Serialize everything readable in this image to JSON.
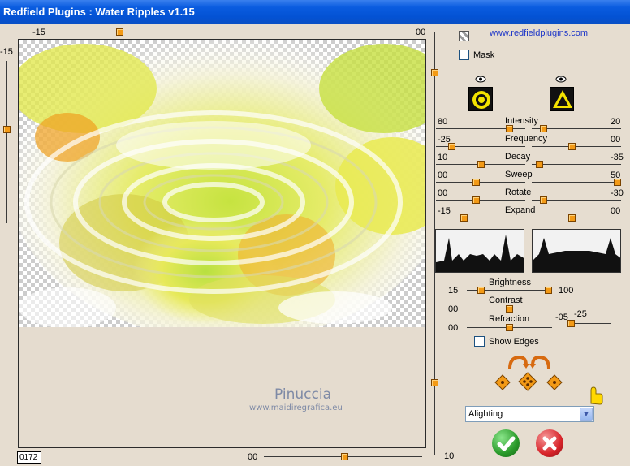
{
  "window": {
    "title": "Redfield Plugins : Water Ripples v1.15"
  },
  "top_slider": {
    "left_value": "-15",
    "right_value": "00",
    "level": 0.45
  },
  "left_slider": {
    "value": "-15",
    "level": 0.45
  },
  "bottom_slider": {
    "left_value": "00",
    "level": 0.55
  },
  "right_vertical_slider": {
    "value": "10",
    "level": 0.25
  },
  "link": {
    "text": "www.redfieldplugins.com"
  },
  "mask": {
    "label": "Mask",
    "checked": false
  },
  "icons": {
    "ripple_circle": "ripple-circle-icon",
    "ripple_triangle": "ripple-triangle-icon",
    "eye": "eye-icon"
  },
  "params": [
    {
      "label": "Intensity",
      "left_value": "80",
      "right_value": "20",
      "left_level": 0.85,
      "right_level": 0.1
    },
    {
      "label": "Frequency",
      "left_value": "-25",
      "right_value": "00",
      "left_level": 0.15,
      "right_level": 0.45
    },
    {
      "label": "Decay",
      "left_value": "10",
      "right_value": "-35",
      "left_level": 0.5,
      "right_level": 0.05
    },
    {
      "label": "Sweep",
      "left_value": "00",
      "right_value": "50",
      "left_level": 0.45,
      "right_level": 1.0
    },
    {
      "label": "Rotate",
      "left_value": "00",
      "right_value": "-30",
      "left_level": 0.45,
      "right_level": 0.1
    },
    {
      "label": "Expand",
      "left_value": "-15",
      "right_value": "00",
      "left_level": 0.3,
      "right_level": 0.45
    }
  ],
  "brightness": {
    "label": "Brightness",
    "left_value": "15",
    "right_value": "100",
    "level": 1.0
  },
  "contrast": {
    "label": "Contrast",
    "left_value": "00",
    "level": 0.5
  },
  "refraction": {
    "label": "Refraction",
    "left_value": "00",
    "level": 0.5,
    "x_value": "-05",
    "y_value": "-25"
  },
  "show_edges": {
    "label": "Show Edges",
    "checked": false
  },
  "lighting": {
    "selected": "Alighting"
  },
  "counter": {
    "value": "0172"
  },
  "watermark": {
    "line1": "Pinuccia",
    "line2": "www.maidiregrafica.eu"
  },
  "colors": {
    "title_bar": "#0a5ce0",
    "thumb": "#f39a16",
    "ok_green": "#2a9a2a",
    "cancel_red": "#d8242a"
  }
}
